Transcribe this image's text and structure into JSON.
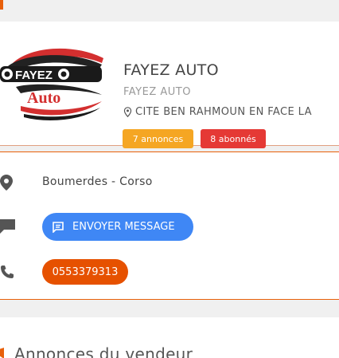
{
  "profile": {
    "name": "FAYEZ AUTO",
    "subtitle": "FAYEZ AUTO",
    "address": "CITE BEN RAHMOUN EN FACE LA",
    "logo": {
      "top_text": "FAYEZ",
      "bottom_text": "Auto"
    },
    "annonces_badge": "7 annonces",
    "abonnes_badge": "8 abonnés"
  },
  "contact": {
    "location": "Boumerdes - Corso",
    "message_button": "ENVOYER MESSAGE",
    "phone": "0553379313"
  },
  "seller_section": {
    "title": "Annonces du vendeur"
  },
  "colors": {
    "accent": "#e8600a",
    "message_button": "#3f87f5",
    "phone_button": "#e65100",
    "annonces_badge": "#f5a623",
    "abonnes_badge": "#e53935"
  },
  "icons": [
    "location-pin-icon",
    "chat-icon",
    "message-icon",
    "phone-icon",
    "megaphone-icon"
  ]
}
